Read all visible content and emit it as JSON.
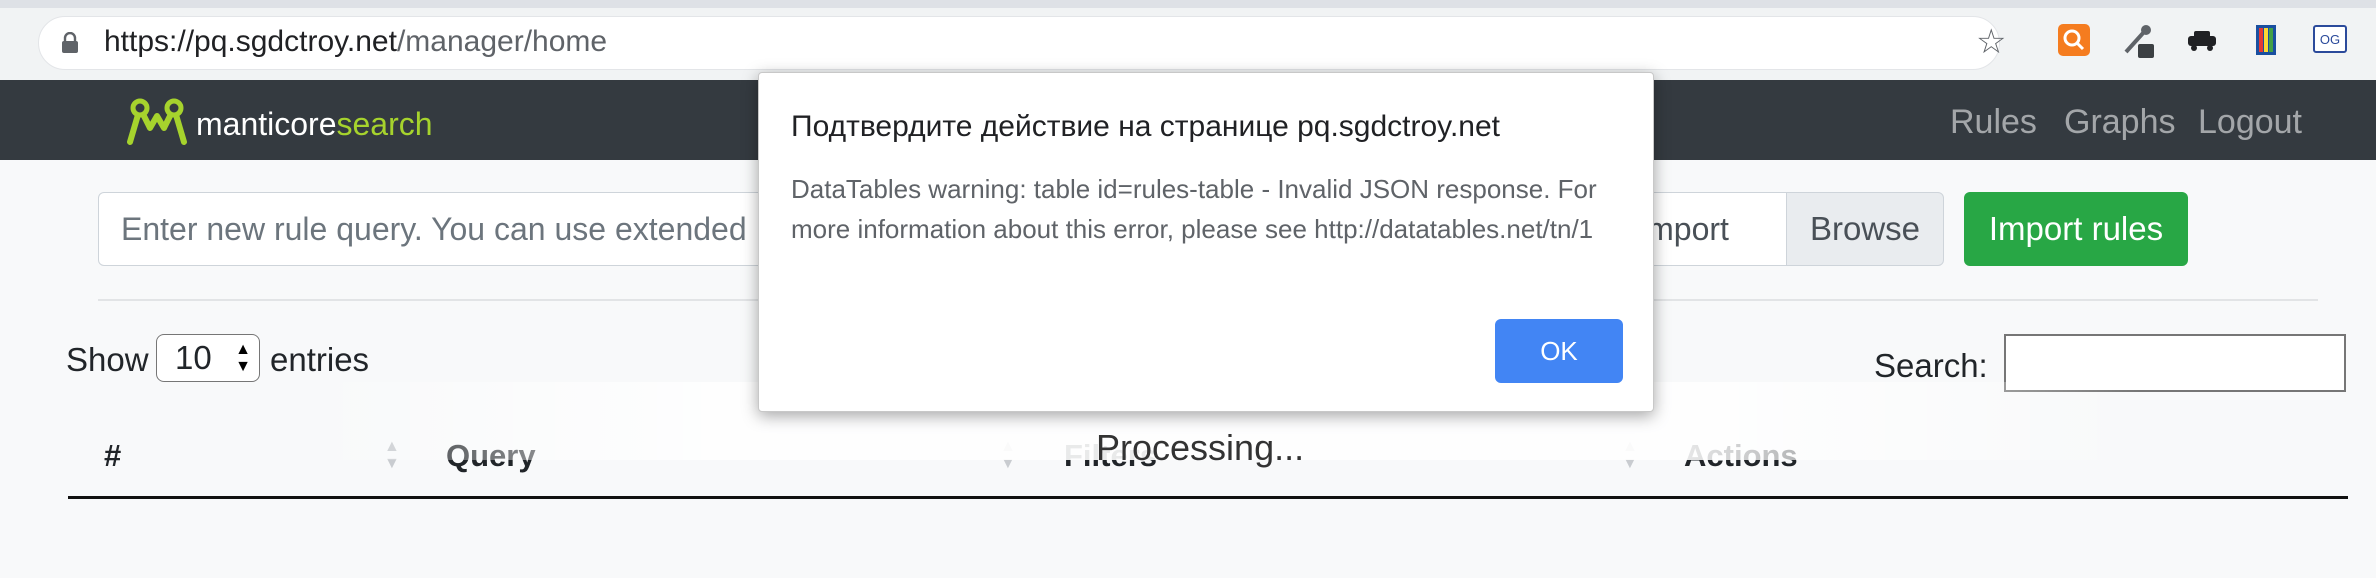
{
  "browser": {
    "url_host": "https://pq.sgdctroy.net",
    "url_path": "/manager/home"
  },
  "navbar": {
    "brand_main": "manticore",
    "brand_accent": "search",
    "links": [
      "Rules",
      "Graphs",
      "Logout"
    ]
  },
  "form": {
    "rule_placeholder": "Enter new rule query. You can use extended",
    "file_label": "import",
    "browse_label": "Browse",
    "import_label": "Import rules"
  },
  "table": {
    "show_label": "Show",
    "page_length": "10",
    "entries_label": "entries",
    "search_label": "Search:",
    "columns": [
      "#",
      "Query",
      "Filters",
      "Actions"
    ],
    "processing": "Processing..."
  },
  "dialog": {
    "title": "Подтвердите действие на странице pq.sgdctroy.net",
    "message": "DataTables warning: table id=rules-table - Invalid JSON response. For more information about this error, please see http://datatables.net/tn/1",
    "ok_label": "OK"
  },
  "colors": {
    "navbar": "#343a40",
    "brand_accent": "#a6d32d",
    "import_button": "#28a745",
    "dialog_ok": "#4285f4"
  }
}
